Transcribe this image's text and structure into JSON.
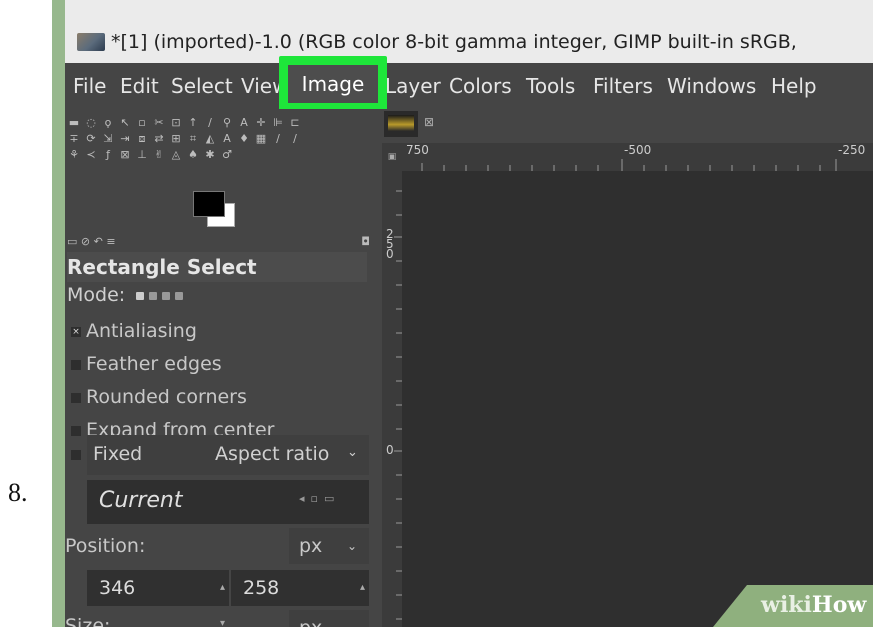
{
  "step": {
    "number": "8."
  },
  "window": {
    "title": "*[1] (imported)-1.0 (RGB color 8-bit gamma integer, GIMP built-in sRGB,"
  },
  "menubar": {
    "file": "File",
    "edit": "Edit",
    "select": "Select",
    "view": "View",
    "image": "Image",
    "layer": "Layer",
    "colors": "Colors",
    "tools": "Tools",
    "filters": "Filters",
    "windows": "Windows",
    "help": "Help",
    "highlight_color": "#1ee63a"
  },
  "tool_options": {
    "tool_name": "Rectangle Select",
    "mode_label": "Mode:",
    "antialiasing": "Antialiasing",
    "feather_edges": "Feather edges",
    "rounded_corners": "Rounded corners",
    "expand_from_center": "Expand from center",
    "fixed_label": "Fixed",
    "fixed_option": "Aspect ratio",
    "current_value": "Current",
    "position_label": "Position:",
    "position_unit": "px",
    "position_x": "346",
    "position_y": "258",
    "size_label": "Size:",
    "size_unit": "px"
  },
  "canvas": {
    "hruler_marks": [
      "750",
      "-500",
      "-250"
    ],
    "vruler_marks": [
      "250",
      "0"
    ]
  },
  "watermark": {
    "wiki": "wiki",
    "how": "How"
  }
}
